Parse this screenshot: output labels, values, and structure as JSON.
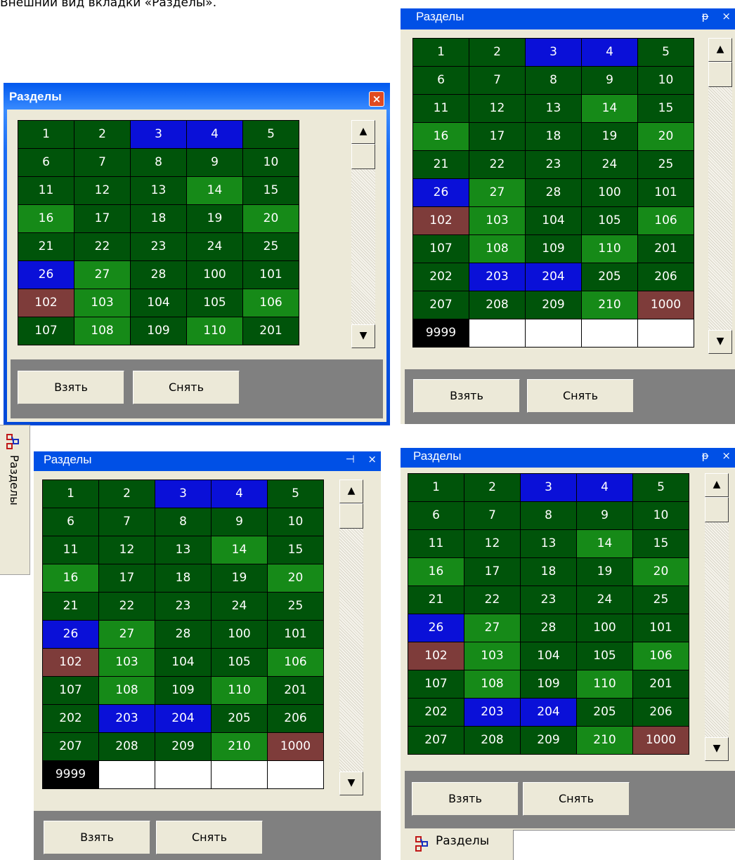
{
  "caption": "Внешний вид вкладки «Разделы».",
  "panel_title": "Разделы",
  "window_controls": {
    "pin": "ᵽ",
    "pin_horizontal": "⊣",
    "close": "×"
  },
  "buttons": {
    "take": "Взять",
    "release": "Снять"
  },
  "side_tab_label": "Разделы",
  "colors": {
    "dark_green": "#00540a",
    "bright_green": "#168a18",
    "blue": "#0a10d8",
    "brown": "#7e3c3a",
    "black": "#000000",
    "empty": "#ffffff"
  },
  "sections": [
    {
      "n": "1",
      "s": "dg"
    },
    {
      "n": "2",
      "s": "dg"
    },
    {
      "n": "3",
      "s": "bl"
    },
    {
      "n": "4",
      "s": "bl"
    },
    {
      "n": "5",
      "s": "dg"
    },
    {
      "n": "6",
      "s": "dg"
    },
    {
      "n": "7",
      "s": "dg"
    },
    {
      "n": "8",
      "s": "dg"
    },
    {
      "n": "9",
      "s": "dg"
    },
    {
      "n": "10",
      "s": "dg"
    },
    {
      "n": "11",
      "s": "dg"
    },
    {
      "n": "12",
      "s": "dg"
    },
    {
      "n": "13",
      "s": "dg"
    },
    {
      "n": "14",
      "s": "bg"
    },
    {
      "n": "15",
      "s": "dg"
    },
    {
      "n": "16",
      "s": "bg"
    },
    {
      "n": "17",
      "s": "dg"
    },
    {
      "n": "18",
      "s": "dg"
    },
    {
      "n": "19",
      "s": "dg"
    },
    {
      "n": "20",
      "s": "bg"
    },
    {
      "n": "21",
      "s": "dg"
    },
    {
      "n": "22",
      "s": "dg"
    },
    {
      "n": "23",
      "s": "dg"
    },
    {
      "n": "24",
      "s": "dg"
    },
    {
      "n": "25",
      "s": "dg"
    },
    {
      "n": "26",
      "s": "bl"
    },
    {
      "n": "27",
      "s": "bg"
    },
    {
      "n": "28",
      "s": "dg"
    },
    {
      "n": "100",
      "s": "dg"
    },
    {
      "n": "101",
      "s": "dg"
    },
    {
      "n": "102",
      "s": "br"
    },
    {
      "n": "103",
      "s": "bg"
    },
    {
      "n": "104",
      "s": "dg"
    },
    {
      "n": "105",
      "s": "dg"
    },
    {
      "n": "106",
      "s": "bg"
    },
    {
      "n": "107",
      "s": "dg"
    },
    {
      "n": "108",
      "s": "bg"
    },
    {
      "n": "109",
      "s": "dg"
    },
    {
      "n": "110",
      "s": "bg"
    },
    {
      "n": "201",
      "s": "dg"
    },
    {
      "n": "202",
      "s": "dg"
    },
    {
      "n": "203",
      "s": "bl"
    },
    {
      "n": "204",
      "s": "bl"
    },
    {
      "n": "205",
      "s": "dg"
    },
    {
      "n": "206",
      "s": "dg"
    },
    {
      "n": "207",
      "s": "dg"
    },
    {
      "n": "208",
      "s": "dg"
    },
    {
      "n": "209",
      "s": "dg"
    },
    {
      "n": "210",
      "s": "bg"
    },
    {
      "n": "1000",
      "s": "br"
    },
    {
      "n": "9999",
      "s": "bk"
    },
    {
      "n": "",
      "s": "wh"
    },
    {
      "n": "",
      "s": "wh"
    },
    {
      "n": "",
      "s": "wh"
    },
    {
      "n": "",
      "s": "wh"
    }
  ],
  "scroll_icons": {
    "up": "▲",
    "down": "▼"
  }
}
